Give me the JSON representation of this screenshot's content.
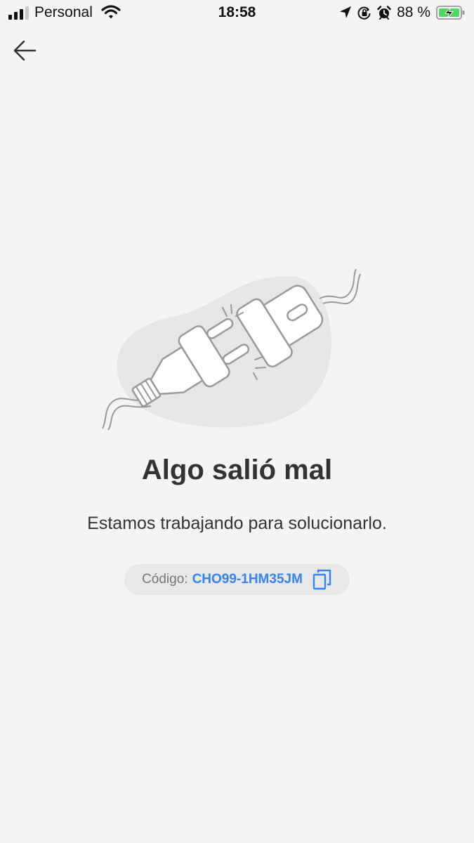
{
  "status_bar": {
    "carrier": "Personal",
    "time": "18:58",
    "battery_percent": "88 %",
    "icons": [
      "signal-icon",
      "wifi-icon",
      "location-icon",
      "orientation-lock-icon",
      "alarm-icon",
      "battery-charging-icon"
    ]
  },
  "nav": {
    "back_icon": "arrow-left-icon"
  },
  "error": {
    "illustration": "unplugged-plug-icon",
    "title": "Algo salió mal",
    "message": "Estamos trabajando para solucionarlo.",
    "code_label": "Código:",
    "code_value": "CHO99-1HM35JM",
    "copy_icon": "copy-icon"
  },
  "colors": {
    "background": "#f4f4f4",
    "accent": "#3483fa",
    "pill": "#e8e8e8",
    "battery": "#4cd964"
  }
}
